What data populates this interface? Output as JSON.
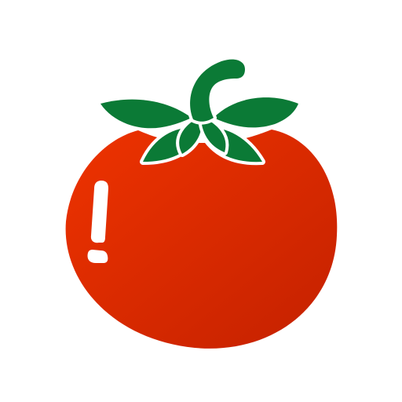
{
  "icon": {
    "name": "tomato-icon",
    "colors": {
      "body_light": "#ee3300",
      "body_dark": "#c42100",
      "leaf": "#0b7a36",
      "highlight": "#ffffff",
      "background": "#ffffff"
    }
  }
}
